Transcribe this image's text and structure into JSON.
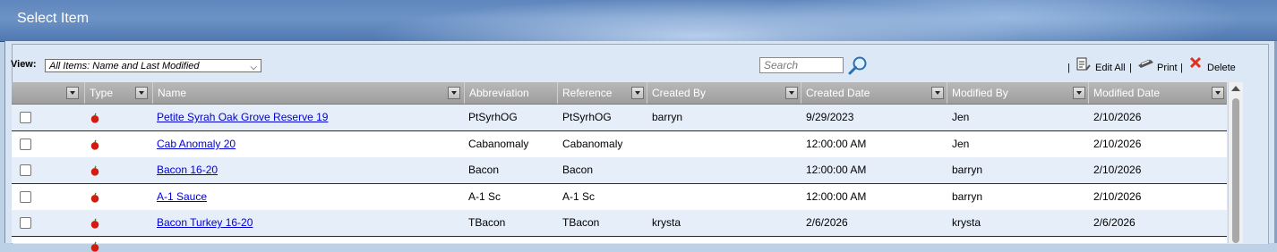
{
  "window": {
    "title": "Select Item"
  },
  "toolbar": {
    "view_label": "View:",
    "view_value": "All Items: Name and Last Modified",
    "search_placeholder": "Search",
    "sep1": "|",
    "edit_all": "Edit All",
    "sep2": "|",
    "print": "Print",
    "sep3": "|",
    "delete": "Delete"
  },
  "columns": [
    "Type",
    "Name",
    "Abbreviation",
    "Reference",
    "Created By",
    "Created Date",
    "Modified By",
    "Modified Date"
  ],
  "rows": [
    {
      "name": "Petite Syrah Oak Grove Reserve 19",
      "abbreviation": "PtSyrhOG",
      "reference": "PtSyrhOG",
      "created_by": "barryn",
      "created_date": "9/29/2023",
      "modified_by": "Jen",
      "modified_date": "2/10/2026"
    },
    {
      "name": "Cab Anomaly 20",
      "abbreviation": "Cabanomaly",
      "reference": "Cabanomaly",
      "created_by": "",
      "created_date": "12:00:00 AM",
      "modified_by": "Jen",
      "modified_date": "2/10/2026"
    },
    {
      "name": "Bacon 16-20",
      "abbreviation": "Bacon",
      "reference": "Bacon",
      "created_by": "",
      "created_date": "12:00:00 AM",
      "modified_by": "barryn",
      "modified_date": "2/10/2026"
    },
    {
      "name": "A-1 Sauce",
      "abbreviation": "A-1 Sc",
      "reference": "A-1 Sc",
      "created_by": "",
      "created_date": "12:00:00 AM",
      "modified_by": "barryn",
      "modified_date": "2/10/2026"
    },
    {
      "name": "Bacon Turkey 16-20",
      "abbreviation": "TBacon",
      "reference": "TBacon",
      "created_by": "krysta",
      "created_date": "2/6/2026",
      "modified_by": "krysta",
      "modified_date": "2/6/2026"
    }
  ],
  "icons": {
    "row_type": "apple-icon",
    "search": "magnifier-icon",
    "edit_all": "edit-all-icon",
    "print": "printer-icon",
    "delete": "delete-x-icon"
  },
  "colors": {
    "titlebar": "#5f86bd",
    "link": "#0000d8",
    "header": "#a9a9a9",
    "row_alt": "#e6eefa",
    "delete_x": "#e03020"
  }
}
